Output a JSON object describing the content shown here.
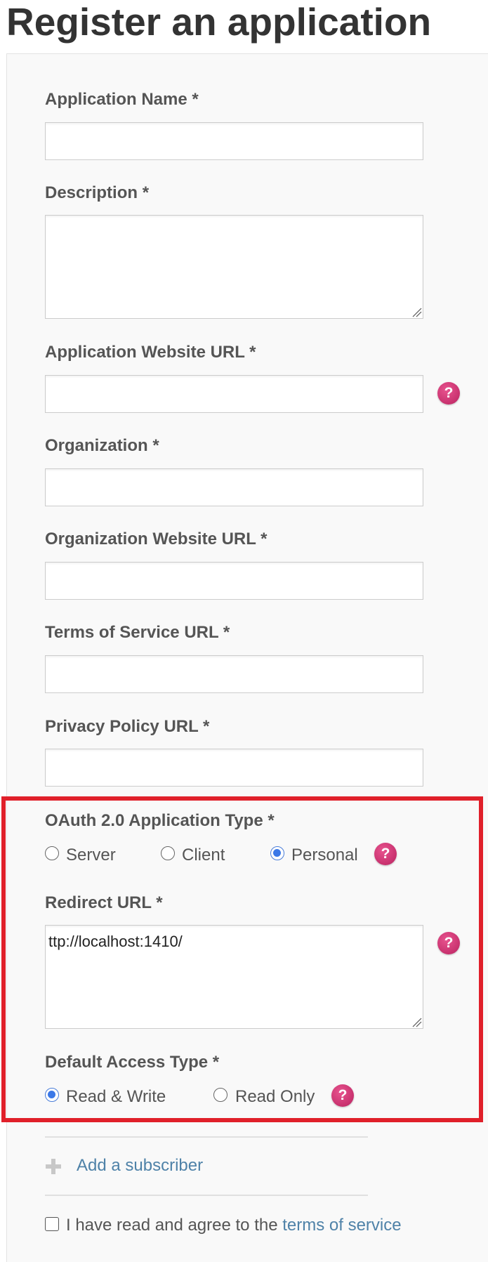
{
  "page": {
    "title": "Register an application"
  },
  "form": {
    "app_name": {
      "label": "Application Name *",
      "value": ""
    },
    "description": {
      "label": "Description *",
      "value": ""
    },
    "app_website": {
      "label": "Application Website URL *",
      "value": ""
    },
    "organization": {
      "label": "Organization *",
      "value": ""
    },
    "org_website": {
      "label": "Organization Website URL *",
      "value": ""
    },
    "tos_url": {
      "label": "Terms of Service URL *",
      "value": ""
    },
    "privacy_url": {
      "label": "Privacy Policy URL *",
      "value": ""
    },
    "oauth_type": {
      "label": "OAuth 2.0 Application Type *",
      "options": [
        "Server",
        "Client",
        "Personal"
      ],
      "selected": "Personal"
    },
    "redirect_url": {
      "label": "Redirect URL *",
      "value": "ttp://localhost:1410/"
    },
    "access_type": {
      "label": "Default Access Type *",
      "options": [
        "Read & Write",
        "Read Only"
      ],
      "selected": "Read & Write"
    },
    "help_glyph": "?",
    "add_subscriber": {
      "label": "Add a subscriber"
    },
    "agree": {
      "prefix": "I have read and agree to the ",
      "link": "terms of service",
      "checked": false
    }
  },
  "colors": {
    "help_icon": "#c8316e",
    "link": "#4f82a8",
    "highlight": "#e0202a",
    "radio_selected": "#3b78e7"
  },
  "icons": {
    "help": "question-mark-circle-icon",
    "add": "plus-icon",
    "resize": "resize-grip-icon"
  }
}
